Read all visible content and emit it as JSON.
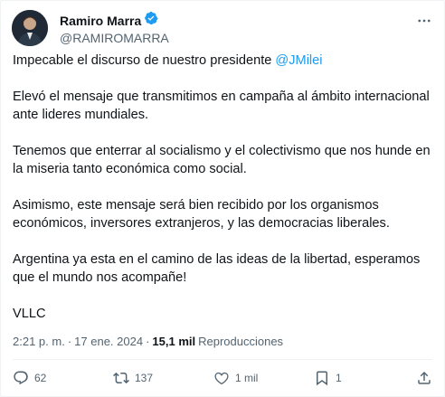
{
  "author": {
    "display_name": "Ramiro Marra",
    "handle": "@RAMIROMARRA",
    "verified": true,
    "verified_color": "#1d9bf0"
  },
  "post": {
    "intro_text": "Impecable el discurso de nuestro presidente ",
    "mention": "@JMilei",
    "paragraphs": [
      "Elevó el mensaje que transmitimos en campaña al ámbito internacional ante lideres mundiales.",
      "Tenemos que enterrar al socialismo y el colectivismo que nos hunde en la miseria tanto económica como social.",
      "Asimismo, este mensaje será bien recibido por los organismos económicos, inversores extranjeros, y las democracias liberales.",
      "Argentina ya esta en el camino de las ideas de la libertad, esperamos que el mundo nos acompañe!",
      "VLLC"
    ]
  },
  "meta": {
    "time": "2:21 p. m.",
    "separator": "·",
    "date": "17 ene. 2024",
    "views_count": "15,1 mil",
    "views_label": "Reproducciones"
  },
  "actions": {
    "replies": "62",
    "reposts": "137",
    "likes": "1 mil",
    "bookmarks": "1"
  },
  "icons": [
    "more-icon",
    "verified-badge-icon",
    "reply-icon",
    "repost-icon",
    "like-icon",
    "bookmark-icon",
    "share-icon"
  ],
  "colors": {
    "accent": "#1d9bf0",
    "text": "#0f1419",
    "secondary": "#536471"
  }
}
